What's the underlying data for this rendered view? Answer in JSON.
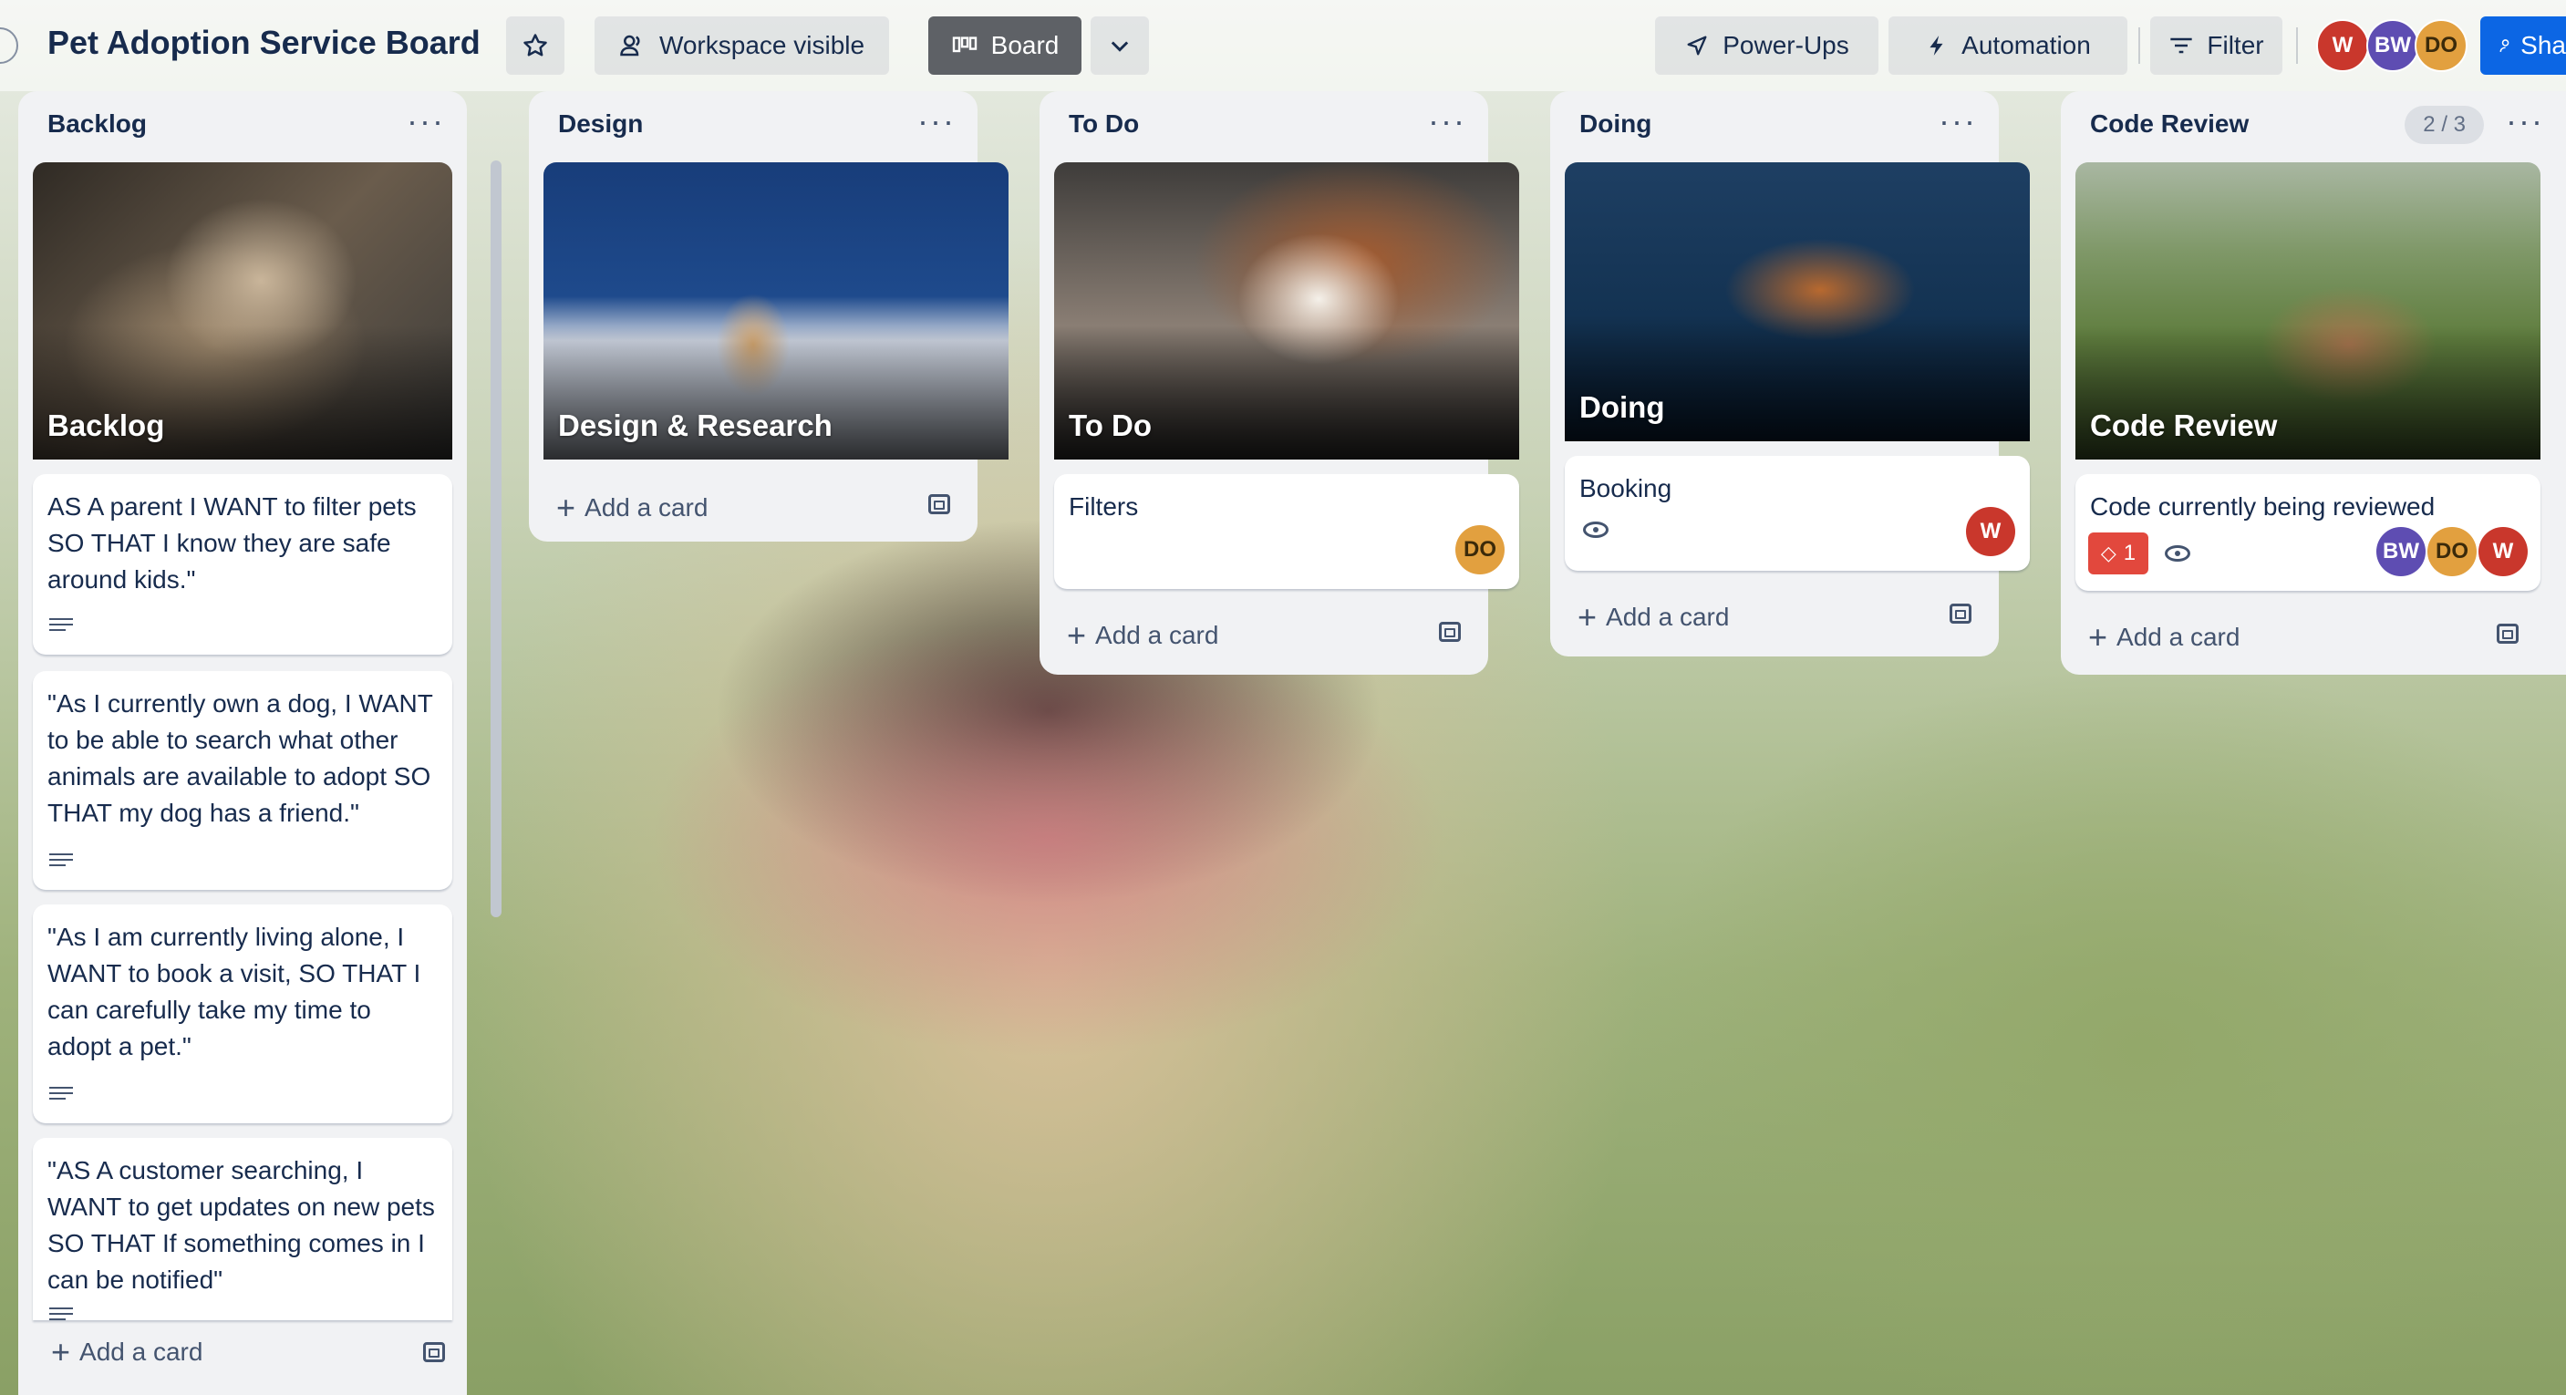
{
  "header": {
    "board_title": "Pet Adoption Service Board",
    "workspace_label": "Workspace visible",
    "board_view_label": "Board",
    "powerups_label": "Power-Ups",
    "automation_label": "Automation",
    "filter_label": "Filter",
    "share_label": "Sha",
    "members": [
      {
        "initials": "W",
        "color": "#c9372c"
      },
      {
        "initials": "BW",
        "color": "#5e4db2"
      },
      {
        "initials": "DO",
        "color": "#e2a03f"
      }
    ]
  },
  "lists": [
    {
      "title": "Backlog",
      "cover_title": "Backlog",
      "cards": [
        "AS A parent I WANT to filter pets SO THAT I know they are safe around kids.\"",
        "\"As I currently own a dog, I WANT to be able to search what other animals are available to adopt SO THAT my dog has a friend.\"",
        "\"As I am currently living alone, I WANT to book a visit, SO THAT I can carefully take my time to adopt a pet.\"",
        "\"AS A customer searching, I WANT to get updates on new pets SO THAT If something comes in I can be notified\""
      ],
      "add_card": "Add a card"
    },
    {
      "title": "Design",
      "cover_title": "Design & Research",
      "add_card": "Add a card"
    },
    {
      "title": "To Do",
      "cover_title": "To Do",
      "cards": [
        "Filters"
      ],
      "card_member": "DO",
      "add_card": "Add a card"
    },
    {
      "title": "Doing",
      "cover_title": "Doing",
      "cards": [
        "Booking"
      ],
      "card_member": "W",
      "add_card": "Add a card"
    },
    {
      "title": "Code Review",
      "count": "2 / 3",
      "cover_title": "Code Review",
      "cards": [
        "Code currently being reviewed"
      ],
      "badge_count": "1",
      "card_members": [
        "BW",
        "DO",
        "W"
      ],
      "add_card": "Add a card"
    }
  ],
  "colors": {
    "list_bg": "#f1f2f4",
    "primary_blue": "#0c66e4",
    "label_red": "#e2483d"
  }
}
